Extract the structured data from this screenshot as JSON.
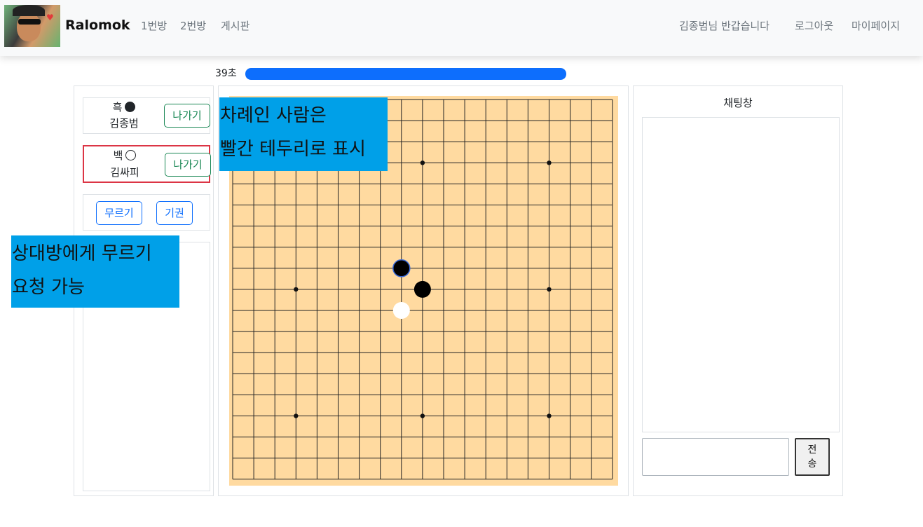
{
  "navbar": {
    "brand": "Ralomok",
    "links": [
      "1번방",
      "2번방",
      "게시판"
    ],
    "greeting": "김종범님 반갑습니다",
    "logout": "로그아웃",
    "mypage": "마이페이지"
  },
  "timer": {
    "label": "39초",
    "progress_percent": 100,
    "color": "#0d6efd"
  },
  "players": [
    {
      "color_label": "흑",
      "stone": "black",
      "name": "김종범",
      "leave_label": "나가기",
      "is_turn": false
    },
    {
      "color_label": "백",
      "stone": "white",
      "name": "김싸피",
      "leave_label": "나가기",
      "is_turn": true
    }
  ],
  "actions": {
    "undo_label": "무르기",
    "resign_label": "기권"
  },
  "board": {
    "size": 19,
    "background": "#ffdaa0",
    "line_color": "#222222",
    "star_points": [
      [
        3,
        3
      ],
      [
        3,
        9
      ],
      [
        3,
        15
      ],
      [
        9,
        3
      ],
      [
        9,
        9
      ],
      [
        9,
        15
      ],
      [
        15,
        3
      ],
      [
        15,
        9
      ],
      [
        15,
        15
      ]
    ],
    "stones": [
      {
        "col": 8,
        "row": 8,
        "color": "black",
        "last_move": true
      },
      {
        "col": 9,
        "row": 9,
        "color": "black",
        "last_move": false
      },
      {
        "col": 8,
        "row": 10,
        "color": "white",
        "last_move": false
      }
    ]
  },
  "chat": {
    "title": "채팅창",
    "input_value": "",
    "send_label": "전\n송"
  },
  "annotations": {
    "turn_note": "차례인 사람은\n빨간 테두리로 표시",
    "undo_note": "상대방에게 무르기\n요청 가능"
  },
  "colors": {
    "turn_border": "#dc3545",
    "annotation_bg": "#00a0e8"
  }
}
